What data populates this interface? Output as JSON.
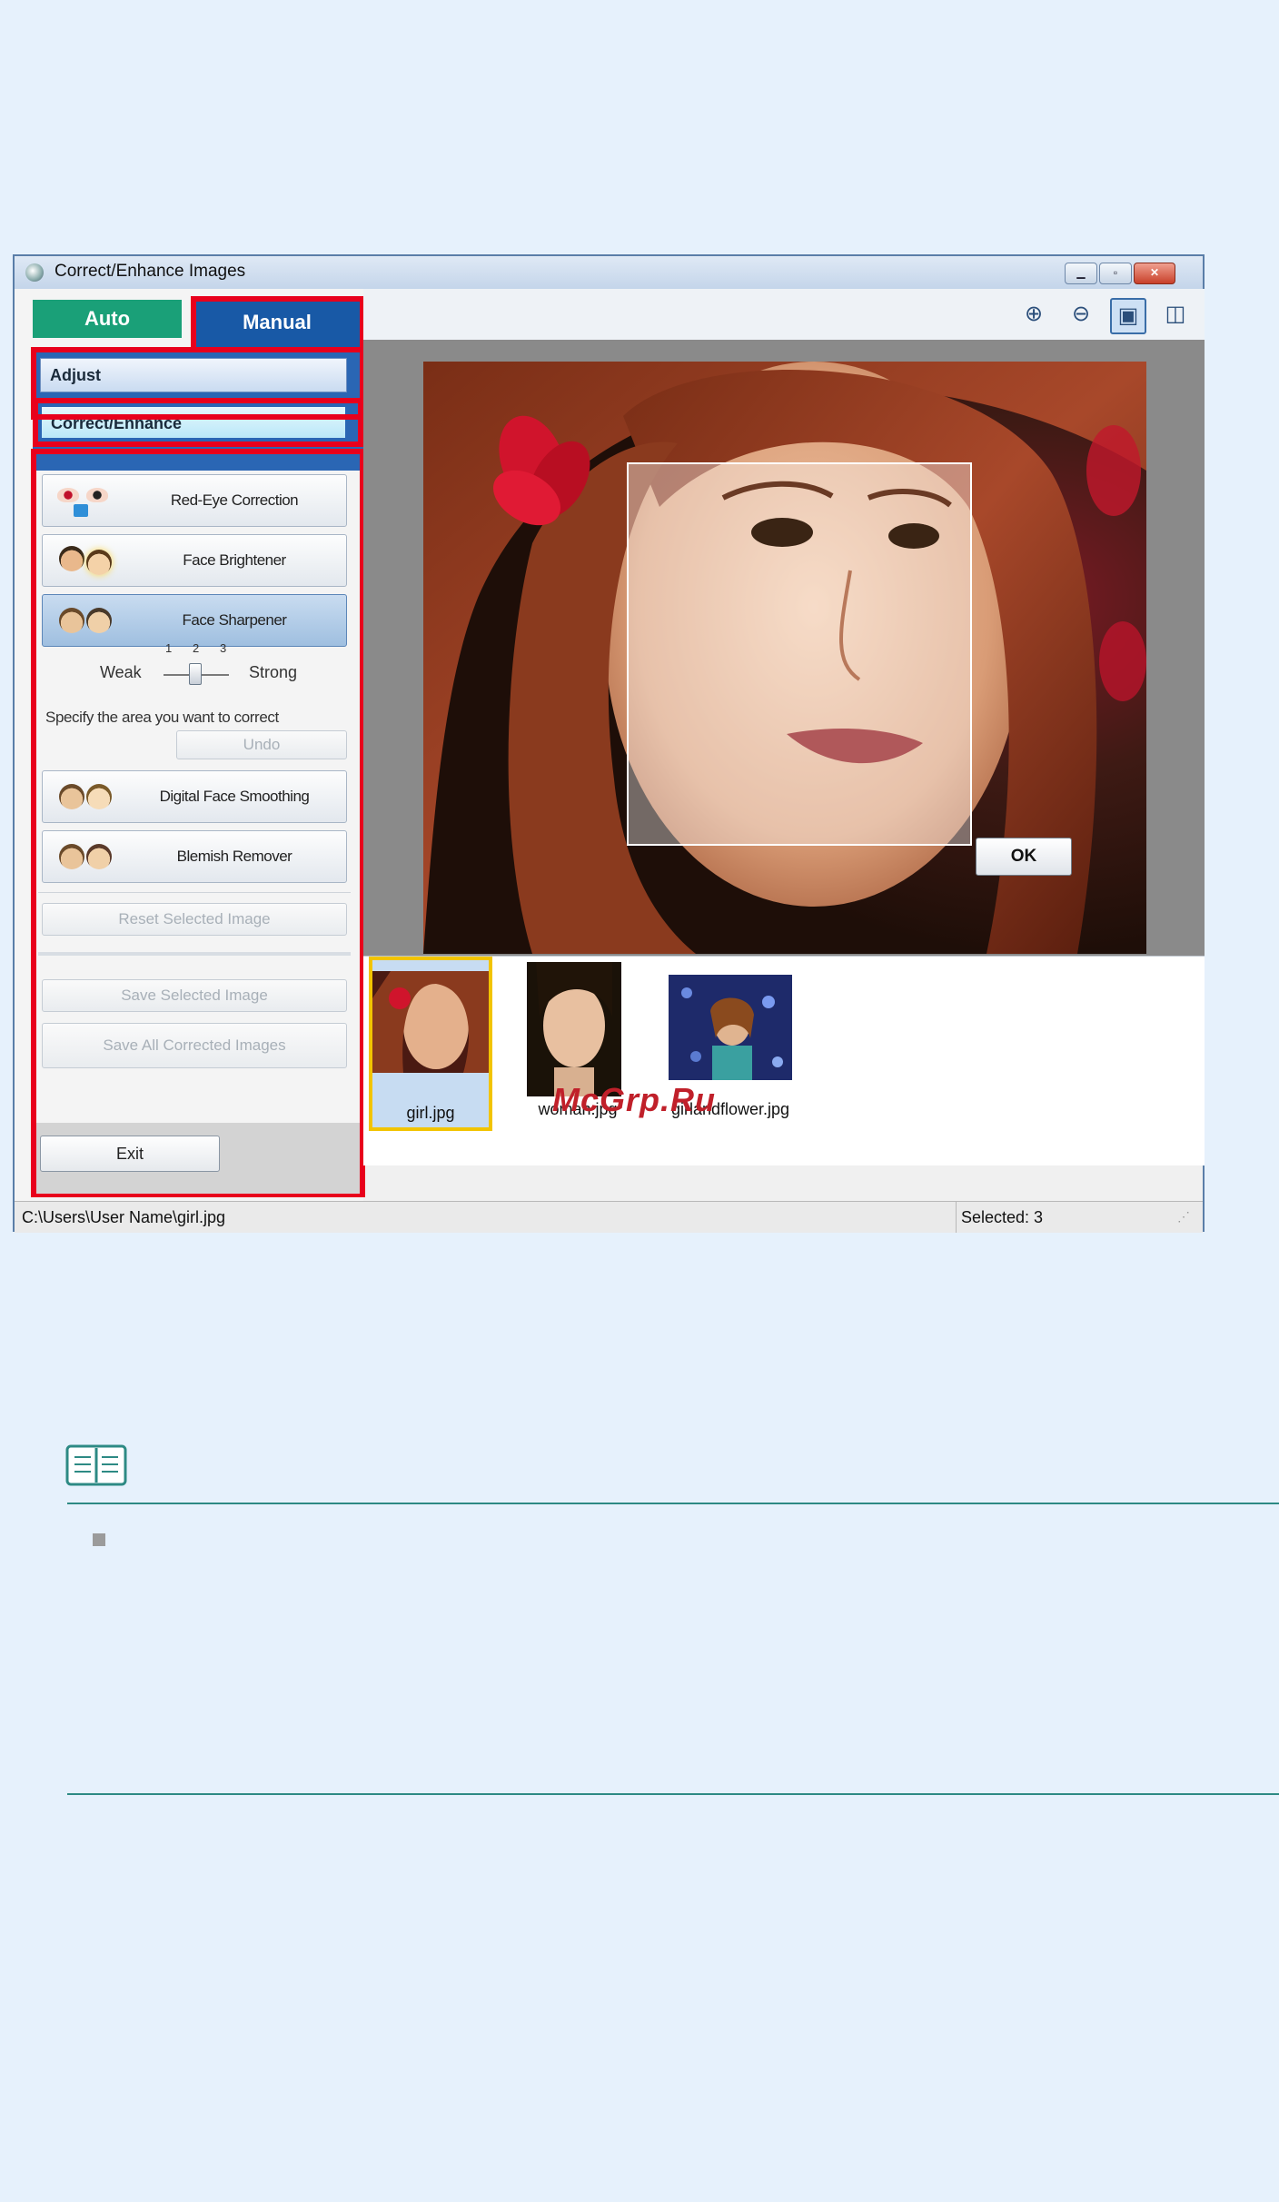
{
  "window": {
    "title": "Correct/Enhance Images"
  },
  "tabs": {
    "auto": "Auto",
    "manual": "Manual"
  },
  "nav": {
    "adjust": "Adjust",
    "correct_enhance": "Correct/Enhance"
  },
  "tools": {
    "red_eye": "Red-Eye Correction",
    "face_brightener": "Face Brightener",
    "face_sharpener": "Face Sharpener",
    "digital_face_smoothing": "Digital Face Smoothing",
    "blemish_remover": "Blemish Remover"
  },
  "slider": {
    "weak": "Weak",
    "strong": "Strong",
    "ticks": [
      "1",
      "2",
      "3"
    ],
    "value": 2
  },
  "hint": "Specify the area you want to correct",
  "buttons": {
    "undo": "Undo",
    "reset_selected": "Reset Selected Image",
    "save_selected": "Save Selected Image",
    "save_all": "Save All Corrected Images",
    "exit": "Exit",
    "ok": "OK"
  },
  "thumbnails": [
    {
      "label": "girl.jpg",
      "selected": true
    },
    {
      "label": "woman.jpg",
      "selected": false
    },
    {
      "label": "girlandflower.jpg",
      "selected": false
    }
  ],
  "status": {
    "path": "C:\\Users\\User Name\\girl.jpg",
    "selected": "Selected: 3"
  },
  "watermark": "McGrp.Ru",
  "colors": {
    "highlight_red": "#e8001c",
    "auto_tab": "#1aa078",
    "manual_tab": "#1859a6",
    "note_rule": "#2d8a84"
  }
}
